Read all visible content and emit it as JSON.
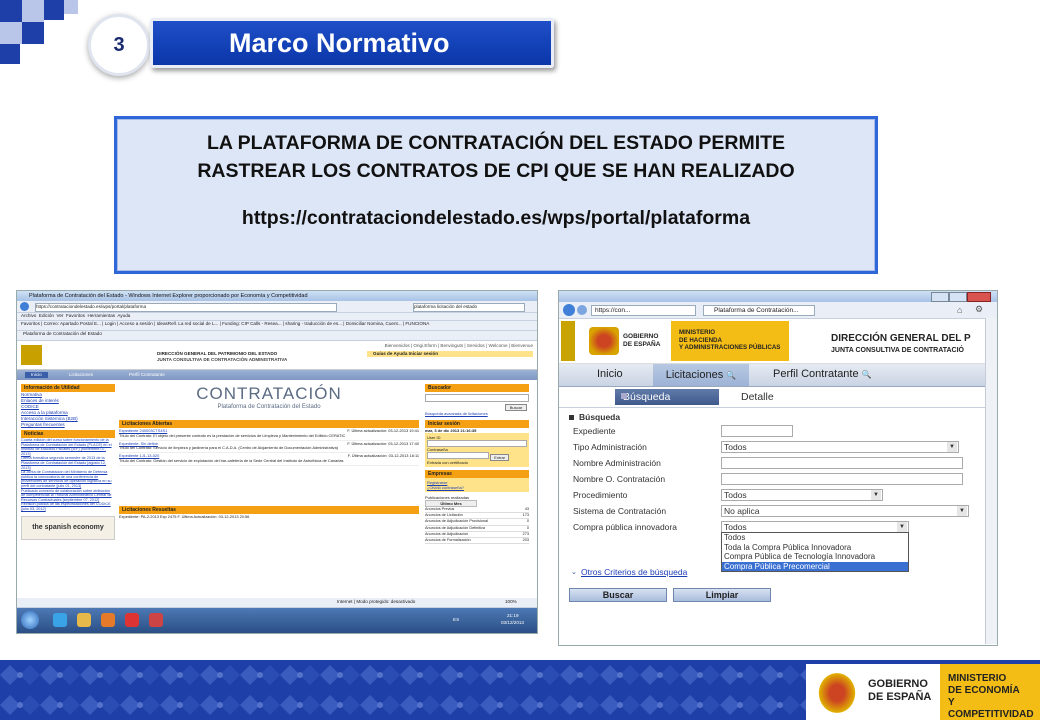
{
  "slide": {
    "section_number": "3",
    "title": "Marco Normativo"
  },
  "info_box": {
    "line1": "LA PLATAFORMA DE CONTRATACIÓN DEL ESTADO PERMITE",
    "line2": "RASTREAR LOS CONTRATOS DE CPI QUE SE HAN REALIZADO",
    "url": "https://contrataciondelestado.es/wps/portal/plataforma"
  },
  "left_shot": {
    "window_title": "Plataforma de Contratación del Estado - Windows Internet Explorer proporcionado por Economía y Competitividad",
    "address": "https://contrataciondelestado.es/wps/portal/plataforma",
    "search_box": "plataforma licitación del estado",
    "menu": [
      "Archivo",
      "Edición",
      "Ver",
      "Favoritos",
      "Herramientas",
      "Ayuda"
    ],
    "favorites": [
      "Favoritos",
      "Correo: Apartado Postal E...",
      "Login",
      "Acceso a sesión",
      "IdeasRell. La red social de L...",
      "Funding: CIP Calls - Resea...",
      "sharing - traducción de es...",
      "Domiciliar Nomina, Cuent...",
      "FUNCIONA"
    ],
    "tab_title": "Plataforma de Contratación del Estado",
    "header_top_links": "Bienvenidos | Origi.Eform | Benvinguts | Servidos | Welcome | Bienvenue",
    "header_center": "DIRECCIÓN GENERAL DEL PATRIMONIO DEL ESTADO",
    "header_center_sub": "JUNTA CONSULTIVA DE CONTRATACIÓN ADMINISTRATIVA",
    "header_help": "Guías de Ayuda   Iniciar sesión",
    "nav": [
      "Inicio",
      "Licitaciones",
      "Perfil Contratante"
    ],
    "logo_main": "CONTRATACIÓN",
    "logo_sub": "Plataforma de Contratación del Estado",
    "sidebar_info_title": "Información de Utilidad",
    "sidebar_info_links": [
      "Normativa",
      "Enlaces de interés",
      "CODICE",
      "Acceso a la plataforma",
      "Interacción Sistemica (B2B)",
      "Preguntas frecuentes"
    ],
    "sidebar_news_title": "Noticias",
    "sidebar_news": [
      "Cuarta edición del curso sobre funcionamiento de la Plataforma de Contratación del Estado (PLACE) en el Instituto de Estudios Fiscales (IEF) [noviembre 07, 2013]",
      "Oferta formativa segundo semestre de 2013 de la Plataforma de Contratación del Estado [agosto 12, 2013]",
      "La Junta de Contratación del Ministerio de Defensa publica la convocatoria de una conferencia de proveedores de servicios de operación logística en su perfil del contratante [julio 01, 2013]",
      "Publicado convenio de colaboración sobre atribución de competencias al Tribunal Administrativo Central de Recursos Contractuales [septiembre 07, 2012]",
      "Revisión pública de las especificaciones del CODICE [julio 03, 2012]"
    ],
    "open_title": "Licitaciones Abiertas",
    "open_items": [
      {
        "exp": "Expediente 240003CTS4S1",
        "update": "F. Última actualización: 03-12-2013 19:41",
        "desc": "Título del Contrato: El objeto del presente contrato es la prestación de servicios de Limpieza y Mantenimiento del Edificio CERATIC"
      },
      {
        "exp": "Expediente: Sin definir",
        "update": "F. Última actualización: 03-12-2013 17:40",
        "desc": "Título del Contrato: Servicio de limpieza y jardinería para el C.A.D.A. (Centro de Alojamiento de Documentación Administrativa)"
      },
      {
        "exp": "Expediente 1J1-13-020",
        "update": "F. Última actualización: 03-12-2013 16:11",
        "desc": "Título del Contrato: Gestión del servicio de explotación del bar-cafetería de la Sede Central del Instituto de Astrofísica de Canarias"
      }
    ],
    "resolved_title": "Licitaciones Resueltas",
    "resolved_item": "Expediente: PA-2-2013 Exp 2475   F. Última Actualización: 03-12-2013 20:56",
    "buscador_title": "Buscador",
    "buscador_button": "Buscar",
    "buscador_link": "Búsqueda avanzada de licitaciones",
    "login_title": "Iniciar sesión",
    "login_date": "mar, 3 de dic 2013 21:16:35",
    "login_user_label": "User ID",
    "login_pass_label": "Contraseña",
    "login_button": "Entrar",
    "login_cert": "Entrada con certificado",
    "companies_title": "Empresas",
    "companies_links": [
      "Registrarse",
      "¿Olvidó contraseña?"
    ],
    "stats_title": "Publicaciones realizadas",
    "stats_header": "Último Mes",
    "stats_rows": [
      {
        "label": "Anuncios Previos",
        "value": "43"
      },
      {
        "label": "Anuncios de Licitación",
        "value": "173"
      },
      {
        "label": "Anuncios de Adjudicación Provisional",
        "value": "0"
      },
      {
        "label": "Anuncios de Adjudicación Definitiva",
        "value": "0"
      },
      {
        "label": "Anuncios de Adjudicación",
        "value": "273"
      },
      {
        "label": "Anuncios de Formalización",
        "value": "203"
      }
    ],
    "spanish_logo": "the spanish economy",
    "status_bar": "Internet | Modo protegido: desactivado",
    "zoom": "100%",
    "taskbar_time": "21:19",
    "taskbar_date": "03/12/2013",
    "taskbar_lang": "ES"
  },
  "right_shot": {
    "address": "https://con...",
    "tab_title": "Plataforma de Contratación...",
    "gov_name_1": "GOBIERNO",
    "gov_name_2": "DE ESPAÑA",
    "ministry_1": "MINISTERIO",
    "ministry_2": "DE HACIENDA",
    "ministry_3": "Y ADMINISTRACIONES PÚBLICAS",
    "header_title": "DIRECCIÓN GENERAL DEL P",
    "header_sub": "JUNTA CONSULTIVA DE CONTRATACIÓ",
    "nav": [
      "Inicio",
      "Licitaciones",
      "Perfil Contratante"
    ],
    "subtabs": [
      "Búsqueda",
      "Detalle"
    ],
    "section_title": "Búsqueda",
    "fields": [
      {
        "label": "Expediente",
        "value": ""
      },
      {
        "label": "Tipo Administración",
        "value": "Todos"
      },
      {
        "label": "Nombre Administración",
        "value": ""
      },
      {
        "label": "Nombre O. Contratación",
        "value": ""
      },
      {
        "label": "Procedimiento",
        "value": "Todos"
      },
      {
        "label": "Sistema de Contratación",
        "value": "No aplica"
      },
      {
        "label": "Compra pública innovadora",
        "value": "Todos"
      }
    ],
    "dropdown_options": [
      "Todos",
      "Toda la Compra Pública Innovadora",
      "Compra Pública de Tecnología Innovadora",
      "Compra Pública Precomercial"
    ],
    "dropdown_selected": "Compra Pública Precomercial",
    "other_criteria": "Otros Criterios de búsqueda",
    "search_button": "Buscar",
    "clear_button": "Limpiar"
  },
  "footer": {
    "gov_1": "GOBIERNO",
    "gov_2": "DE ESPAÑA",
    "ministry_1": "MINISTERIO",
    "ministry_2": "DE ECONOMÍA",
    "ministry_3": "Y COMPETITIVIDAD"
  },
  "colors": {
    "brand_blue": "#1f3fa8",
    "accent_blue": "#2f66d8",
    "info_bg": "#dde6f7",
    "portal_orange": "#f4a012",
    "selection_blue": "#3a70d2"
  }
}
